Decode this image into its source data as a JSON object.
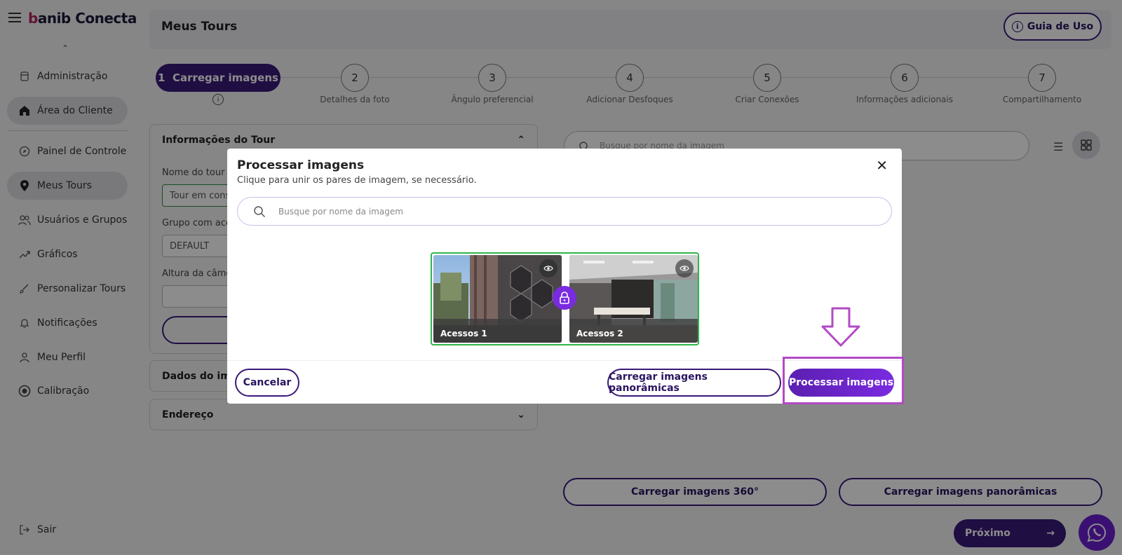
{
  "brand": {
    "logo_b": "b",
    "logo_rest": "anib Conecta"
  },
  "sidebar": {
    "items": [
      {
        "label": "Administração",
        "icon": "lock-icon"
      },
      {
        "label": "Área do Cliente",
        "icon": "home-icon"
      },
      {
        "label": "Painel de Controle",
        "icon": "compass-icon"
      },
      {
        "label": "Meus Tours",
        "icon": "map-pin-icon"
      },
      {
        "label": "Usuários e Grupos",
        "icon": "users-icon"
      },
      {
        "label": "Gráficos",
        "icon": "trend-icon"
      },
      {
        "label": "Personalizar Tours",
        "icon": "brush-icon"
      },
      {
        "label": "Notificações",
        "icon": "bell-icon"
      },
      {
        "label": "Meu Perfil",
        "icon": "user-icon"
      },
      {
        "label": "Calibração",
        "icon": "target-icon"
      }
    ],
    "logout": "Sair"
  },
  "header": {
    "title": "Meus Tours",
    "guide": "Guia de Uso"
  },
  "stepper": {
    "active": {
      "number": "1",
      "label": "Carregar imagens"
    },
    "steps": [
      {
        "number": "2",
        "label": "Detalhes da foto"
      },
      {
        "number": "3",
        "label": "Ângulo preferencial"
      },
      {
        "number": "4",
        "label": "Adicionar Desfoques"
      },
      {
        "number": "5",
        "label": "Criar Conexões"
      },
      {
        "number": "6",
        "label": "Informações adicionais"
      },
      {
        "number": "7",
        "label": "Compartilhamento"
      }
    ]
  },
  "tour_info": {
    "title": "Informações do Tour",
    "name_label": "Nome do tour",
    "name_value": "Tour em cons",
    "group_label": "Grupo com ace",
    "group_value": "DEFAULT",
    "height_label": "Altura da câme"
  },
  "photo_data": {
    "title": "Dados do imó"
  },
  "address": {
    "title": "Endereço"
  },
  "right": {
    "search_placeholder": "Busque por nome da imagem",
    "upload360": "Carregar imagens 360°",
    "upload_pano": "Carregar imagens panorâmicas",
    "next": "Próximo"
  },
  "modal": {
    "title": "Processar imagens",
    "subtitle": "Clique para unir os pares de imagem, se necessário.",
    "search_placeholder": "Busque por nome da imagem",
    "images": [
      {
        "caption": "Acessos 1"
      },
      {
        "caption": "Acessos 2"
      }
    ],
    "cancel": "Cancelar",
    "upload_pano": "Carregar imagens panorâmicas",
    "process": "Processar imagens"
  },
  "colors": {
    "primary": "#3a1a78",
    "accent": "#7a2be0",
    "annotation": "#b24ac4",
    "pair_border": "#2fb54a"
  }
}
